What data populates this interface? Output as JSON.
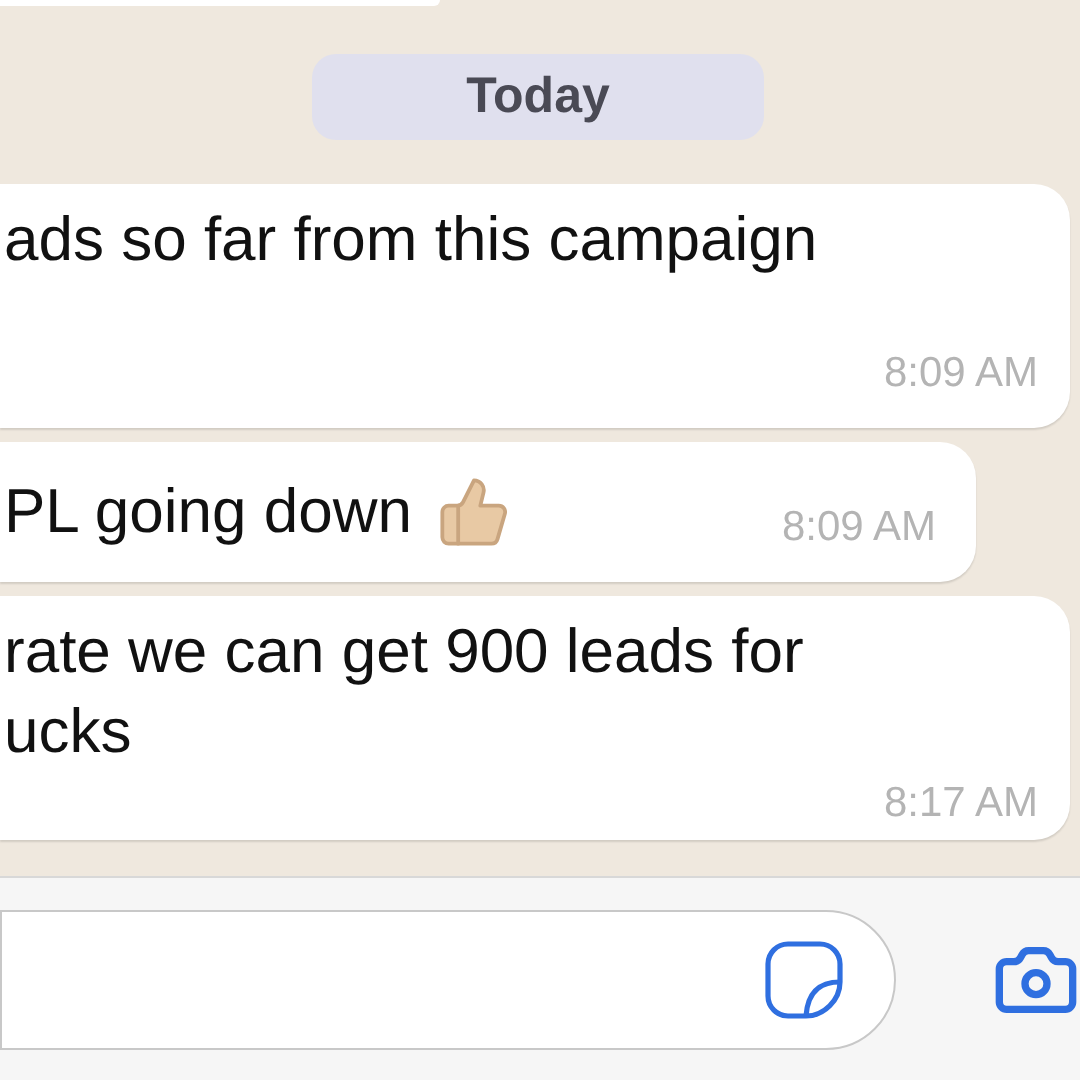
{
  "date_divider": "Today",
  "messages": [
    {
      "kind": "long",
      "lines": [
        "ads so far from this campaign"
      ],
      "emoji": false,
      "time": "8:09 AM"
    },
    {
      "kind": "short",
      "lines": [
        "PL going down"
      ],
      "emoji": true,
      "time": "8:09 AM"
    },
    {
      "kind": "long",
      "lines": [
        "rate we can get 900 leads for",
        "ucks"
      ],
      "emoji": false,
      "time": "8:17 AM"
    }
  ]
}
